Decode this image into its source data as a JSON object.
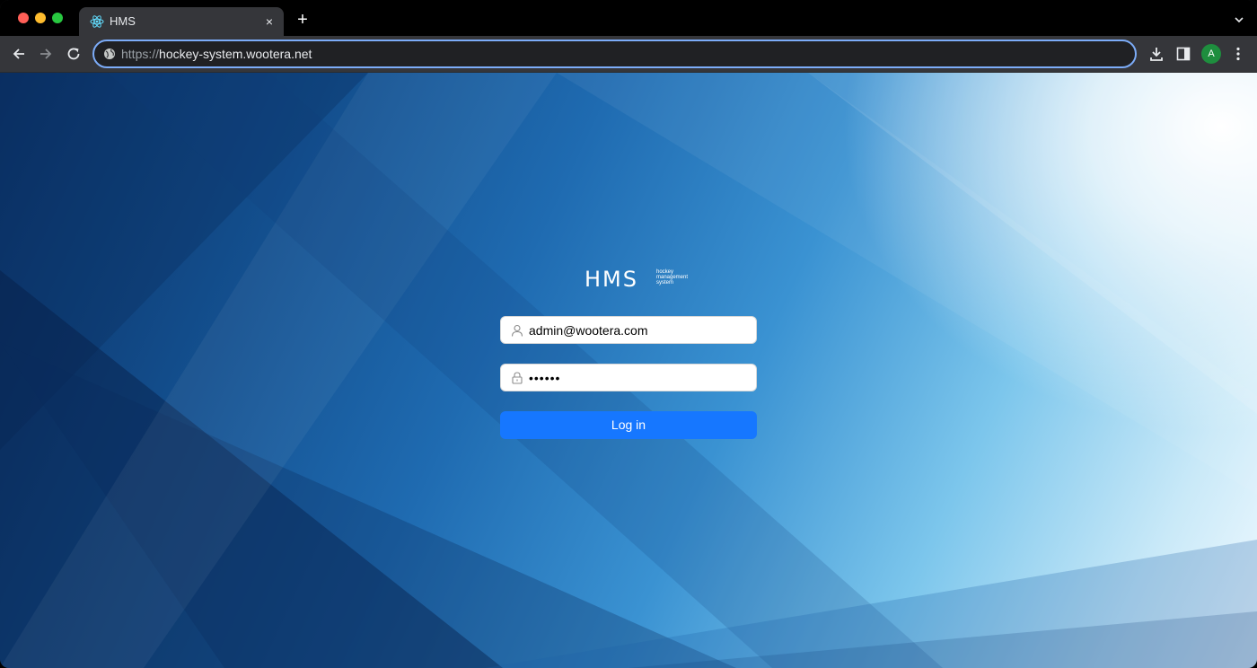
{
  "browser": {
    "tab": {
      "title": "HMS",
      "close_glyph": "×"
    },
    "new_tab_glyph": "+",
    "url": {
      "protocol": "https://",
      "host": "hockey-system.wootera.net"
    },
    "profile_initial": "A",
    "accent_color": "#7cacf8"
  },
  "page": {
    "logo": {
      "main": "HMS",
      "sub": [
        "hockey",
        "management",
        "system"
      ]
    },
    "username": {
      "value": "admin@wootera.com",
      "icon": "user-icon"
    },
    "password": {
      "value": "••••••",
      "icon": "lock-icon"
    },
    "login_button": {
      "label": "Log in",
      "color": "#1677ff"
    }
  }
}
